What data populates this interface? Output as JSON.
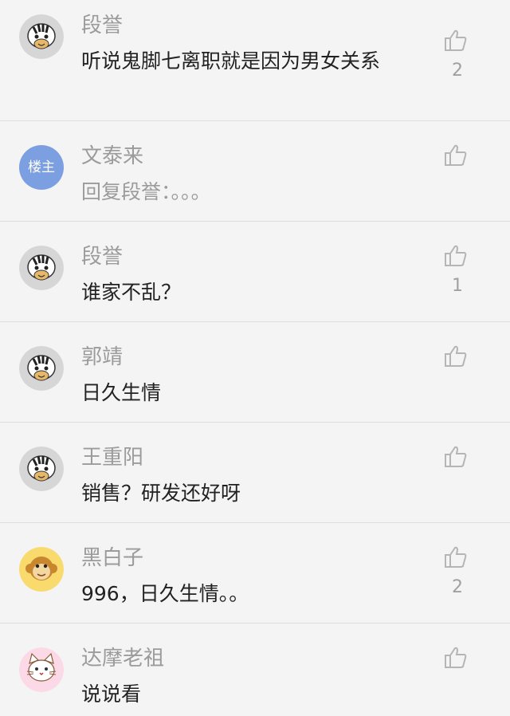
{
  "comments": [
    {
      "name": "段誉",
      "text": "听说鬼脚七离职就是因为男女关系",
      "likes": "2",
      "avatar": "zebra-avatar"
    },
    {
      "name": "文泰来",
      "text": "回复段誉：。。。",
      "likes": "",
      "avatar": "host-badge-avatar",
      "badge": "楼主"
    },
    {
      "name": "段誉",
      "text": "谁家不乱？",
      "likes": "1",
      "avatar": "zebra-avatar"
    },
    {
      "name": "郭靖",
      "text": "日久生情",
      "likes": "",
      "avatar": "zebra-avatar"
    },
    {
      "name": "王重阳",
      "text": "销售？研发还好呀",
      "likes": "",
      "avatar": "zebra-avatar"
    },
    {
      "name": "黑白子",
      "text": "996，日久生情。。",
      "likes": "2",
      "avatar": "monkey-avatar"
    },
    {
      "name": "达摩老祖",
      "text": "说说看",
      "likes": "",
      "avatar": "cat-avatar"
    }
  ],
  "icons": {
    "like": "thumbs-up-icon"
  },
  "colors": {
    "host_badge": "#7b9fe0",
    "monkey_bg": "#f9da6c",
    "cat_bg": "#fbd9e7",
    "zebra_bg": "#d6d6d6"
  }
}
